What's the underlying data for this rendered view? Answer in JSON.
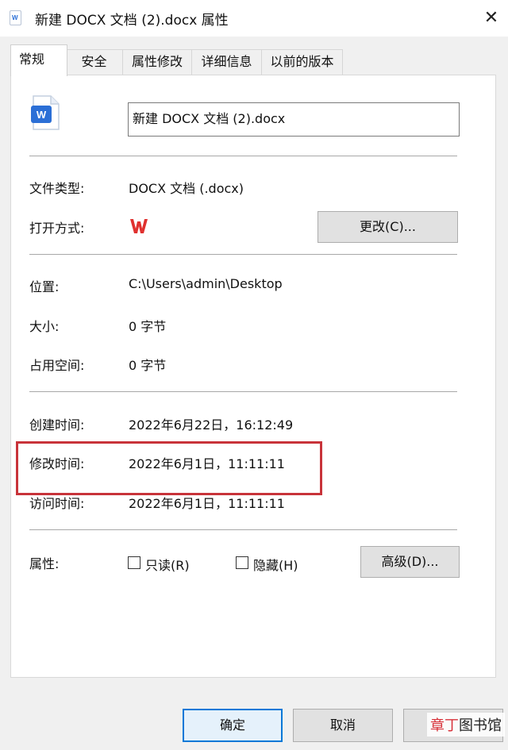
{
  "window": {
    "title": "新建 DOCX 文档 (2).docx 属性",
    "close_glyph": "✕"
  },
  "tabs": [
    {
      "label": "常规",
      "active": true
    },
    {
      "label": "安全"
    },
    {
      "label": "属性修改"
    },
    {
      "label": "详细信息"
    },
    {
      "label": "以前的版本"
    }
  ],
  "general": {
    "file_icon": "wps-document-icon",
    "file_name": "新建 DOCX 文档 (2).docx",
    "file_type_label": "文件类型:",
    "file_type_value": "DOCX 文档 (.docx)",
    "opens_with_label": "打开方式:",
    "opens_with_icon": "wps-logo-icon",
    "change_button": "更改(C)...",
    "location_label": "位置:",
    "location_value": "C:\\Users\\admin\\Desktop",
    "size_label": "大小:",
    "size_value": "0 字节",
    "size_on_disk_label": "占用空间:",
    "size_on_disk_value": "0 字节",
    "created_label": "创建时间:",
    "created_value": "2022年6月22日，16:12:49",
    "modified_label": "修改时间:",
    "modified_value": "2022年6月1日，11:11:11",
    "accessed_label": "访问时间:",
    "accessed_value": "2022年6月1日，11:11:11",
    "attributes_label": "属性:",
    "readonly_label": "只读(R)",
    "readonly_checked": false,
    "hidden_label": "隐藏(H)",
    "hidden_checked": false,
    "advanced_button": "高级(D)..."
  },
  "footer": {
    "ok_button": "确定",
    "cancel_button": "取消",
    "apply_button": "应用"
  },
  "watermark": {
    "part1": "章丁",
    "part2": "图书馆"
  },
  "colors": {
    "highlight_border": "#c8333a",
    "wps_red": "#e0312f",
    "word_blue": "#2b6fd6"
  }
}
